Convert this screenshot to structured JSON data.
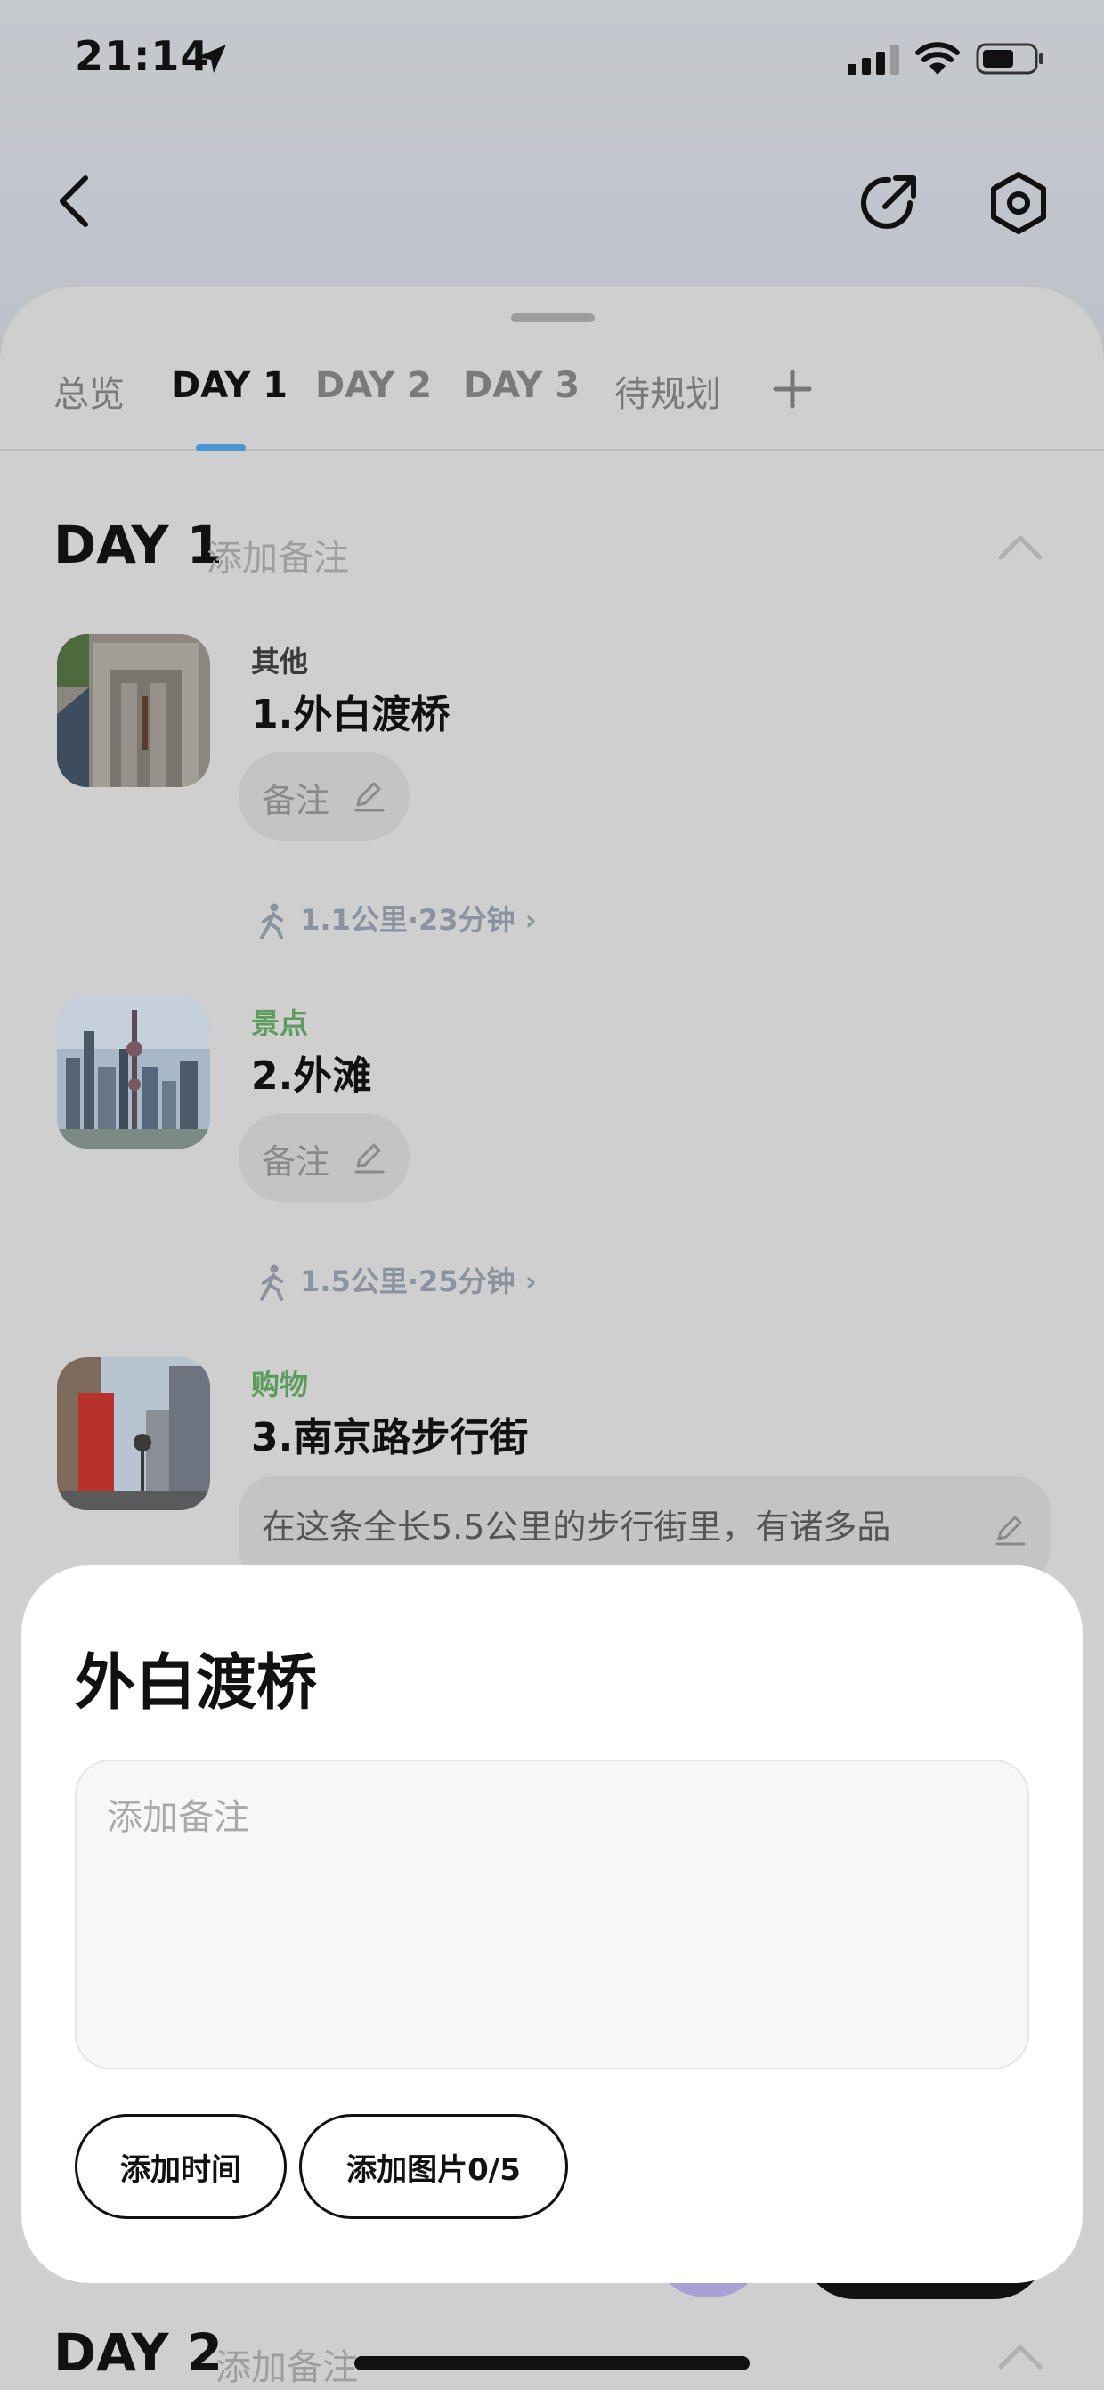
{
  "status_bar": {
    "time": "21:14"
  },
  "tabs": [
    {
      "label": "总览",
      "active": false
    },
    {
      "label": "DAY 1",
      "active": true
    },
    {
      "label": "DAY 2",
      "active": false
    },
    {
      "label": "DAY 3",
      "active": false
    },
    {
      "label": "待规划",
      "active": false
    }
  ],
  "day1": {
    "title": "DAY 1",
    "note_placeholder": "添加备注",
    "pois": [
      {
        "category": "其他",
        "category_color": "#3a3a3a",
        "title": "1.外白渡桥",
        "note_label": "备注"
      },
      {
        "category": "景点",
        "category_color": "#5c9c5c",
        "title": "2.外滩",
        "note_label": "备注"
      },
      {
        "category": "购物",
        "category_color": "#5c9c5c",
        "title": "3.南京路步行街",
        "description": "在这条全长5.5公里的步行街里，有诸多品"
      }
    ],
    "routes": [
      {
        "text": "1.1公里·23分钟"
      },
      {
        "text": "1.5公里·25分钟"
      }
    ]
  },
  "day2": {
    "title": "DAY 2",
    "note_placeholder": "添加备注"
  },
  "dialog": {
    "title": "外白渡桥",
    "input_placeholder": "添加备注",
    "buttons": [
      {
        "label": "添加时间"
      },
      {
        "label": "添加图片0/5"
      }
    ]
  },
  "colors": {
    "accent": "#4a97d6",
    "green_category": "#5c9c5c",
    "route_text": "#8b93a0"
  }
}
